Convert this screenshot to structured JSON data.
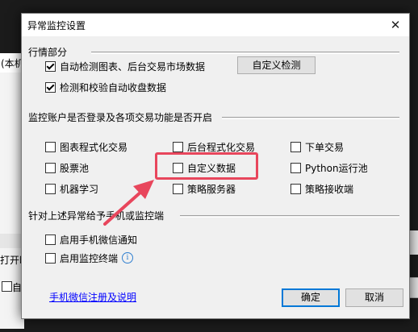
{
  "background": {
    "left_text_1": "(本机",
    "left_text_2": "打开时",
    "left_text_3": "自动"
  },
  "dialog": {
    "title": "异常监控设置",
    "close_glyph": "✕",
    "section_market": {
      "title": "行情部分",
      "auto_detect_label": "自动检测图表、后台交易市场数据",
      "auto_detect_checked": true,
      "verify_label": "检测和校验自动收盘数据",
      "verify_checked": true,
      "custom_detect_button": "自定义检测"
    },
    "section_account": {
      "title": "监控账户是否登录及各项交易功能是否开启",
      "items": [
        {
          "label": "图表程式化交易",
          "checked": false
        },
        {
          "label": "后台程式化交易",
          "checked": false
        },
        {
          "label": "下单交易",
          "checked": false
        },
        {
          "label": "股票池",
          "checked": false
        },
        {
          "label": "自定义数据",
          "checked": false
        },
        {
          "label": "Python运行池",
          "checked": false
        },
        {
          "label": "机器学习",
          "checked": false
        },
        {
          "label": "策略服务器",
          "checked": false
        },
        {
          "label": "策略接收端",
          "checked": false
        }
      ]
    },
    "section_notify": {
      "title": "针对上述异常给予手机或监控端",
      "wechat_label": "启用手机微信通知",
      "wechat_checked": false,
      "terminal_label": "启用监控终端",
      "terminal_checked": false,
      "info_glyph": "i"
    },
    "register_link": "手机微信注册及说明",
    "ok_button": "确定",
    "cancel_button": "取消"
  },
  "colors": {
    "highlight": "#e8465c",
    "link": "#0000ff",
    "accent": "#0078d7"
  }
}
